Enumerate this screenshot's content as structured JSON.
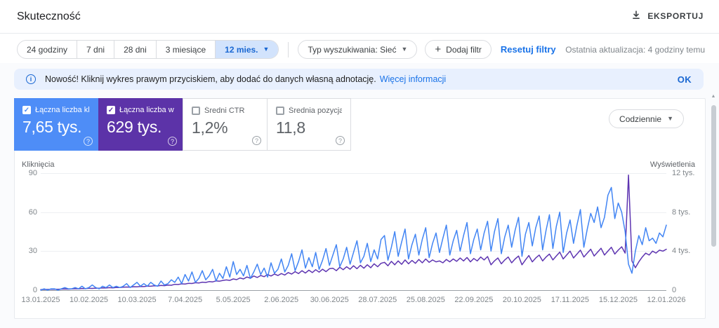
{
  "header": {
    "title": "Skuteczność",
    "export_label": "EKSPORTUJ"
  },
  "filters": {
    "date_ranges": [
      "24 godziny",
      "7 dni",
      "28 dni",
      "3 miesiące",
      "12 mies."
    ],
    "selected_range": "12 mies.",
    "search_type": "Typ wyszukiwania: Sieć",
    "add_filter": "Dodaj filtr",
    "reset_label": "Resetuj filtry",
    "last_update": "Ostatnia aktualizacja: 4 godziny temu"
  },
  "banner": {
    "text": "Nowość! Kliknij wykres prawym przyciskiem, aby dodać do danych własną adnotację.",
    "link": "Więcej informacji",
    "ok": "OK"
  },
  "metrics": {
    "granularity": "Codziennie",
    "cards": [
      {
        "label": "Łączna liczba klik...",
        "value": "7,65 tys.",
        "checked": true,
        "color": "#4e8df7",
        "help": "?"
      },
      {
        "label": "Łączna liczba wy...",
        "value": "629 tys.",
        "checked": true,
        "color": "#5c33a8",
        "help": "?"
      },
      {
        "label": "Średni CTR",
        "value": "1,2%",
        "checked": false,
        "color": "#ffffff",
        "help": "?"
      },
      {
        "label": "Średnia pozycja",
        "value": "11,8",
        "checked": false,
        "color": "#ffffff",
        "help": "?"
      }
    ],
    "check_glyph": "✓"
  },
  "chart_data": {
    "type": "line",
    "grid": true,
    "x_tick_labels": [
      "13.01.2025",
      "10.02.2025",
      "10.03.2025",
      "7.04.2025",
      "5.05.2025",
      "2.06.2025",
      "30.06.2025",
      "28.07.2025",
      "25.08.2025",
      "22.09.2025",
      "20.10.2025",
      "17.11.2025",
      "15.12.2025",
      "12.01.2026"
    ],
    "left_axis": {
      "label": "Kliknięcia",
      "max": 90,
      "ticks": [
        {
          "value": 0,
          "label": "0"
        },
        {
          "value": 30,
          "label": "30"
        },
        {
          "value": 60,
          "label": "60"
        },
        {
          "value": 90,
          "label": "90"
        }
      ]
    },
    "right_axis": {
      "label": "Wyświetlenia",
      "max": 12000,
      "ticks": [
        {
          "value": 0,
          "label": "0"
        },
        {
          "value": 4000,
          "label": "4 tys."
        },
        {
          "value": 8000,
          "label": "8 tys."
        },
        {
          "value": 12000,
          "label": "12 tys."
        }
      ]
    },
    "series": [
      {
        "name": "Kliknięcia",
        "axis": "left",
        "color": "#4285f4",
        "values": [
          0,
          1,
          0,
          1,
          1,
          0,
          1,
          2,
          1,
          1,
          2,
          1,
          3,
          1,
          2,
          4,
          2,
          1,
          3,
          2,
          4,
          2,
          3,
          2,
          3,
          5,
          2,
          4,
          6,
          3,
          5,
          3,
          6,
          4,
          3,
          7,
          4,
          5,
          8,
          6,
          10,
          5,
          12,
          7,
          14,
          6,
          9,
          15,
          8,
          11,
          16,
          7,
          13,
          9,
          18,
          10,
          22,
          12,
          16,
          11,
          19,
          9,
          14,
          20,
          12,
          17,
          10,
          21,
          13,
          16,
          24,
          14,
          19,
          28,
          15,
          22,
          31,
          17,
          25,
          18,
          29,
          16,
          23,
          32,
          19,
          27,
          35,
          18,
          24,
          33,
          20,
          29,
          38,
          21,
          26,
          36,
          22,
          31,
          24,
          39,
          42,
          23,
          33,
          45,
          26,
          37,
          47,
          24,
          35,
          43,
          27,
          39,
          48,
          25,
          36,
          44,
          29,
          40,
          50,
          27,
          38,
          46,
          30,
          42,
          52,
          28,
          39,
          47,
          31,
          44,
          53,
          30,
          45,
          55,
          28,
          41,
          50,
          33,
          46,
          56,
          26,
          43,
          52,
          34,
          48,
          57,
          31,
          46,
          58,
          32,
          49,
          60,
          29,
          44,
          54,
          36,
          50,
          62,
          33,
          47,
          59,
          52,
          64,
          48,
          56,
          73,
          79,
          55,
          67,
          60,
          45,
          20,
          13,
          30,
          42,
          35,
          48,
          38,
          40,
          36,
          44,
          41,
          50
        ]
      },
      {
        "name": "Wyświetlenia",
        "axis": "right",
        "color": "#5e35b1",
        "values": [
          60,
          80,
          70,
          90,
          100,
          90,
          110,
          120,
          110,
          130,
          150,
          140,
          170,
          160,
          190,
          180,
          210,
          200,
          230,
          220,
          260,
          240,
          280,
          270,
          300,
          320,
          310,
          350,
          340,
          380,
          370,
          420,
          400,
          450,
          430,
          480,
          460,
          520,
          500,
          600,
          580,
          650,
          630,
          700,
          680,
          760,
          730,
          820,
          790,
          880,
          850,
          950,
          920,
          1000,
          1050,
          1000,
          1150,
          1080,
          1250,
          1150,
          1350,
          1220,
          1450,
          1300,
          1500,
          1380,
          1600,
          1450,
          1650,
          1500,
          1700,
          1550,
          1800,
          1650,
          1900,
          1700,
          2000,
          1750,
          2050,
          1800,
          2100,
          1850,
          2150,
          1900,
          2200,
          2250,
          2000,
          2350,
          2100,
          2400,
          2150,
          2500,
          2200,
          2550,
          2250,
          2600,
          2300,
          2700,
          2400,
          2750,
          2850,
          2500,
          2950,
          2600,
          3000,
          2650,
          3100,
          2700,
          3050,
          2750,
          3150,
          2800,
          3200,
          2850,
          3100,
          2900,
          3000,
          2800,
          3150,
          2900,
          3200,
          2950,
          3300,
          3000,
          3350,
          2900,
          3250,
          3000,
          3400,
          3100,
          3450,
          2600,
          3000,
          3300,
          2700,
          3100,
          3400,
          2800,
          3200,
          3500,
          2600,
          3100,
          3550,
          2900,
          3300,
          3600,
          3000,
          3400,
          3700,
          3100,
          3500,
          3900,
          3200,
          3600,
          4000,
          3300,
          3700,
          4100,
          3400,
          3800,
          4200,
          3500,
          3900,
          4300,
          3600,
          4000,
          4400,
          3700,
          4100,
          4450,
          3800,
          11800,
          3000,
          2300,
          2900,
          3400,
          3800,
          3600,
          4000,
          3800,
          4100,
          4000,
          4200
        ]
      }
    ]
  }
}
